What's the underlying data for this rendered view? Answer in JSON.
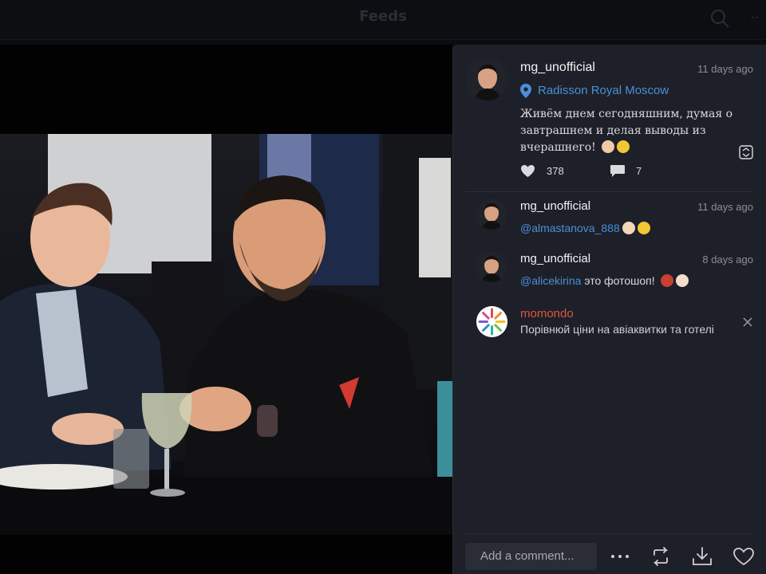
{
  "topbar": {
    "title": "Feeds",
    "search_icon": "search-icon",
    "more_icon": "more-icon"
  },
  "post": {
    "username": "mg_unofficial",
    "time": "11 days ago",
    "location": "Radisson Royal Moscow",
    "caption_lines": [
      "Живём днем сегодняшним, думая о",
      "завтрашнем и делая выводы из",
      "вчерашнего! "
    ],
    "likes": "378",
    "comments": "7"
  },
  "comments": [
    {
      "username": "mg_unofficial",
      "time": "11 days ago",
      "mention": "@almastanova_888",
      "text": ""
    },
    {
      "username": "mg_unofficial",
      "time": "8 days ago",
      "mention": "@alicekirina",
      "text": " это фотошоп! "
    }
  ],
  "ad": {
    "brand": "momondo",
    "text": "Порівнюй ціни на авіаквитки та готелі"
  },
  "footer": {
    "comment_placeholder": "Add a comment..."
  },
  "colors": {
    "panel_bg": "#1d2028",
    "link_blue": "#4b8fd6",
    "ad_brand": "#e0533f"
  }
}
